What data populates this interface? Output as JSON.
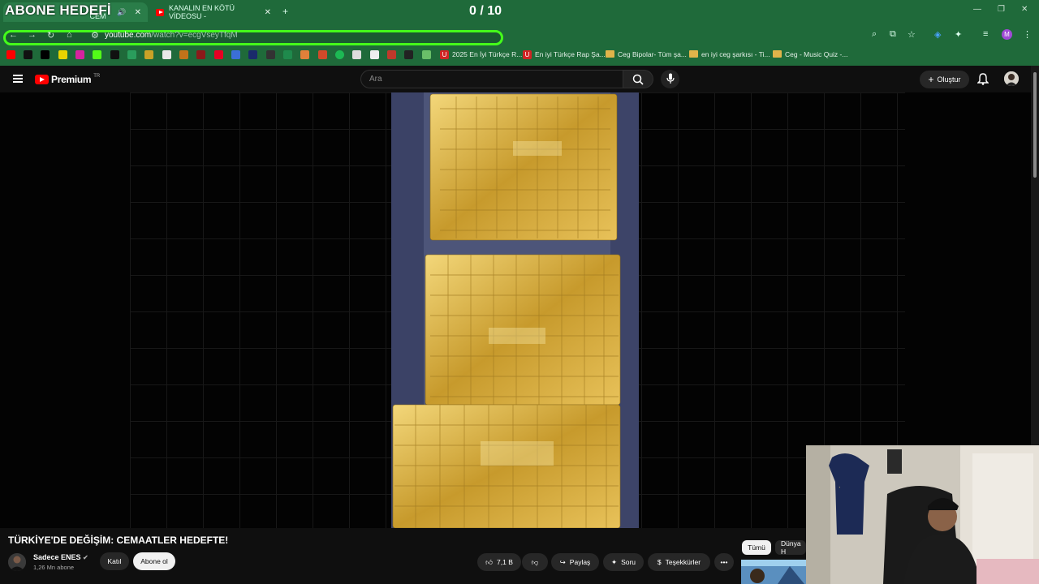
{
  "overlay": {
    "abone_label": "ABONE HEDEFİ",
    "count": "0 / 10"
  },
  "tabs": [
    {
      "label": "...: CEM",
      "active": true
    },
    {
      "label": "KANALIN EN KÖTÜ VİDEOSU -",
      "active": false
    }
  ],
  "address": {
    "domain": "youtube.com",
    "path": "/watch?v=ecgVseyTfqM"
  },
  "bookmarks": [
    {
      "label": "2025 En İyi Türkçe R..."
    },
    {
      "label": "En iyi Türkçe Rap Şa..."
    },
    {
      "label": "Ceg Bipolar- Tüm şa..."
    },
    {
      "label": "en iyi ceg şarkısı - Ti..."
    },
    {
      "label": "Ceg - Music Quiz -..."
    }
  ],
  "header": {
    "logo_text": "Premium",
    "region": "TR",
    "search_placeholder": "Ara",
    "create_label": "Oluştur"
  },
  "video": {
    "title": "TÜRKİYE'DE DEĞİŞİM: CEMAATLER HEDEFTE!",
    "channel_name": "Sadece ENES",
    "subscribers": "1,26 Mn abone",
    "join_label": "Katıl",
    "subscribe_label": "Abone ol",
    "likes": "7,1 B",
    "share_label": "Paylaş",
    "ask_label": "Soru",
    "thanks_label": "Teşekkürler"
  },
  "chips": [
    {
      "label": "Tümü"
    },
    {
      "label": "Dünya H"
    }
  ],
  "colors": {
    "chrome_green": "#1f6a3a",
    "url_highlight": "#44ff1a",
    "yt_red": "#ff0000",
    "gold": "#d4aa3a"
  }
}
